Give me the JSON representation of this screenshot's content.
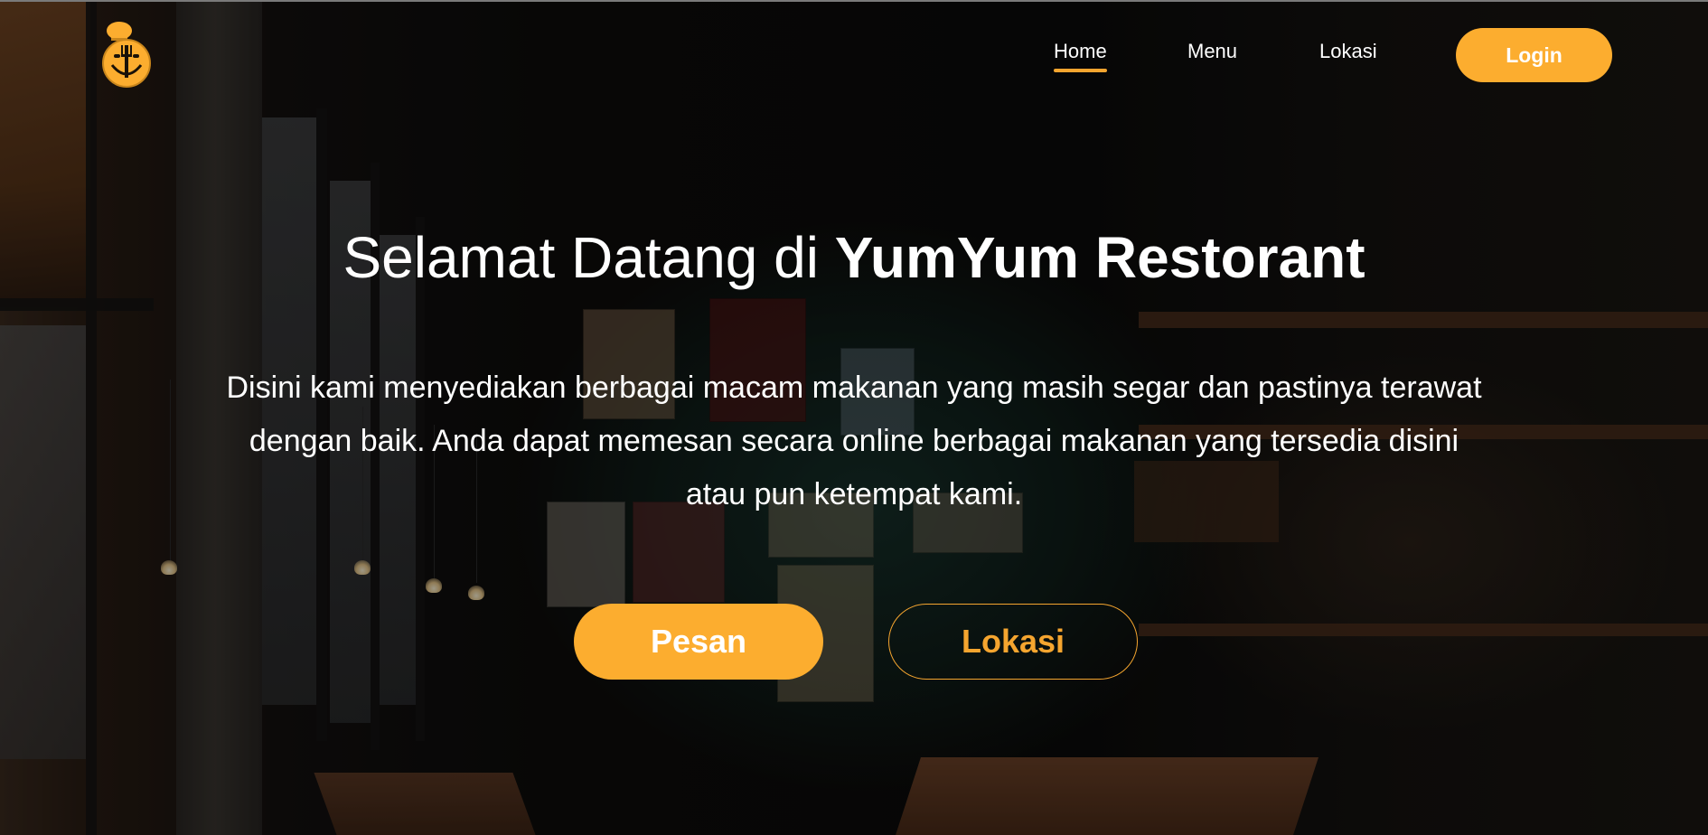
{
  "header": {
    "logo_icon": "chef-smiley-icon",
    "brand_color": "#fcad2f",
    "nav": [
      {
        "label": "Home",
        "active": true
      },
      {
        "label": "Menu",
        "active": false
      },
      {
        "label": "Lokasi",
        "active": false
      }
    ],
    "login_label": "Login"
  },
  "hero": {
    "title_regular": "Selamat Datang di ",
    "title_bold": "YumYum Restorant",
    "description": "Disini kami menyediakan berbagai macam makanan yang masih segar dan pastinya terawat dengan baik. Anda dapat memesan secara online berbagai makanan yang tersedia disini atau pun ketempat kami.",
    "primary_button": "Pesan",
    "secondary_button": "Lokasi"
  }
}
